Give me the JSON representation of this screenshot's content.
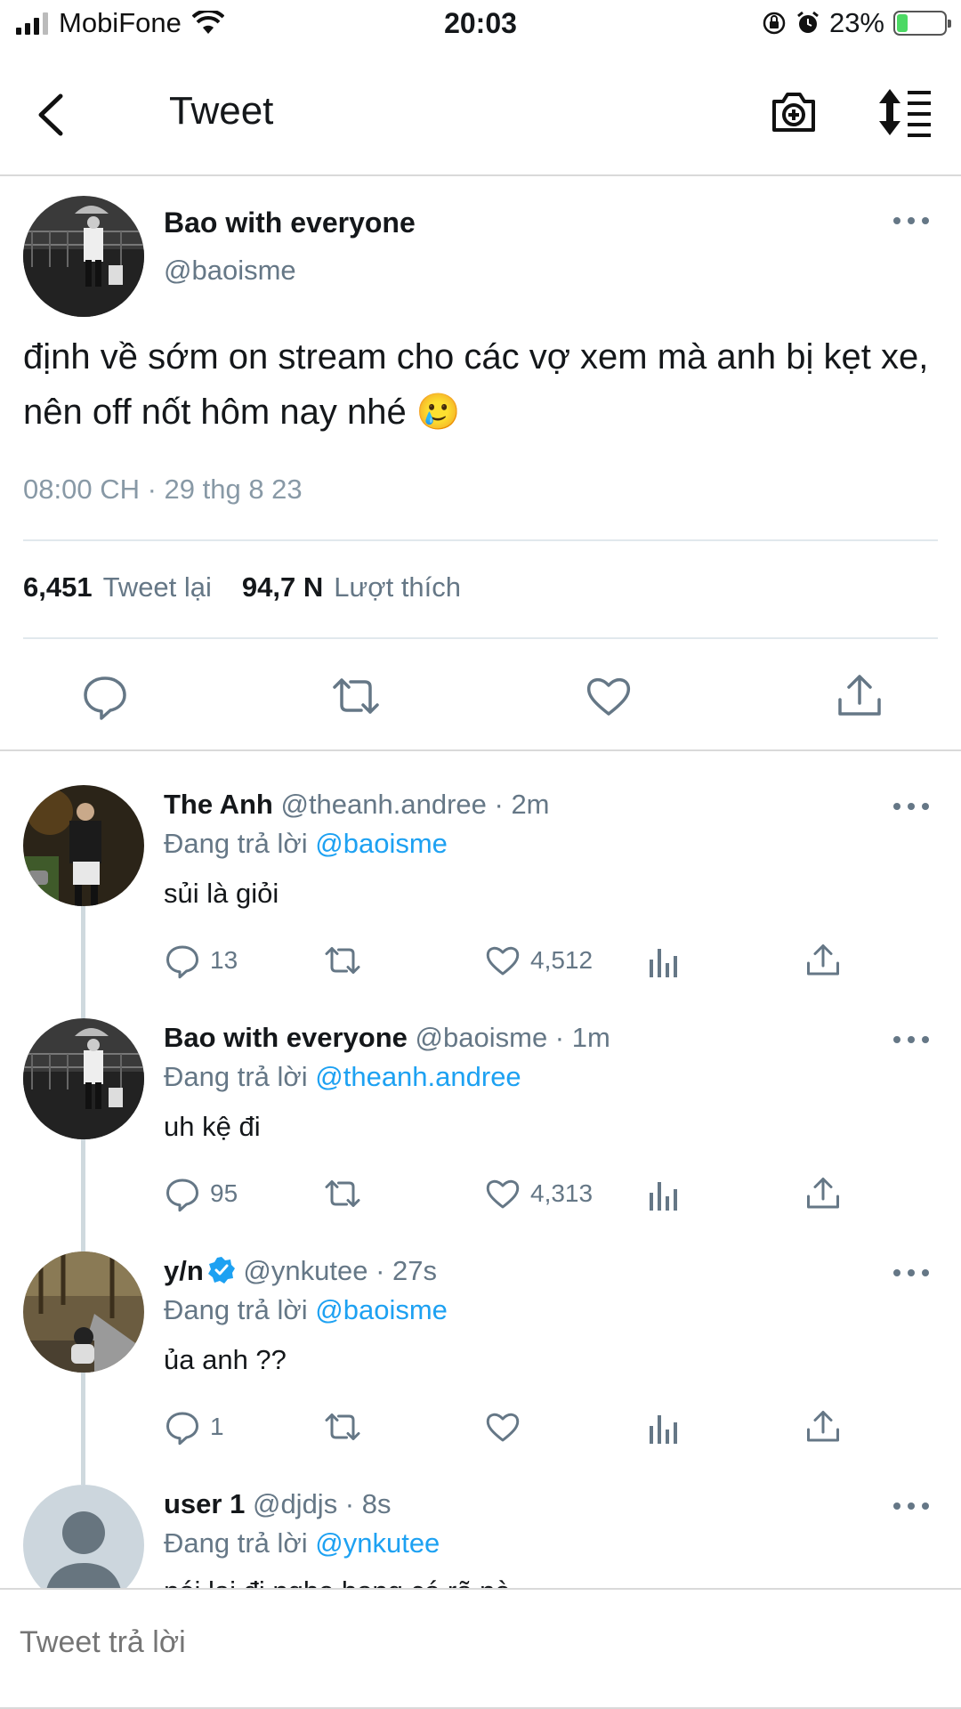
{
  "status_bar": {
    "carrier": "MobiFone",
    "time": "20:03",
    "battery": "23%",
    "battery_level": 0.23
  },
  "header": {
    "title": "Tweet"
  },
  "main_tweet": {
    "name": "Bao with everyone",
    "handle": "@baoisme",
    "text": "định về sớm on stream cho các vợ xem mà anh bị kẹt xe, nên off nốt hôm nay nhé 🥲",
    "timestamp": "08:00 CH · 29 thg 8 23",
    "retweets_count": "6,451",
    "retweets_label": "Tweet lại",
    "likes_count": "94,7 N",
    "likes_label": "Lượt thích"
  },
  "replies": [
    {
      "name": "The Anh",
      "handle": "@theanh.andree · 2m",
      "replying_label": "Đang trả lời",
      "replying_to": "@baoisme",
      "text": "sủi là giỏi",
      "reply_count": "13",
      "like_count": "4,512"
    },
    {
      "name": "Bao with everyone",
      "handle": "@baoisme · 1m",
      "replying_label": "Đang trả lời",
      "replying_to": "@theanh.andree",
      "text": "uh kệ đi",
      "reply_count": "95",
      "like_count": "4,313"
    },
    {
      "name": "y/n",
      "handle": "@ynkutee · 27s",
      "replying_label": "Đang trả lời",
      "replying_to": "@baoisme",
      "text": "ủa anh ??",
      "reply_count": "1",
      "like_count": ""
    },
    {
      "name": "user 1",
      "handle": "@djdjs · 8s",
      "replying_label": "Đang trả lời",
      "replying_to": "@ynkutee",
      "text": "nói lại đi nghe hong có rõ nè"
    }
  ],
  "reply_bar": {
    "placeholder": "Tweet trả lời"
  },
  "colors": {
    "link": "#1da1f2",
    "secondary_text": "#657786",
    "battery_fill": "#4cd964"
  }
}
